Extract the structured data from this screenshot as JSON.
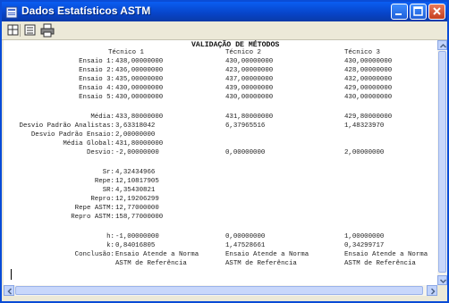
{
  "window": {
    "title": "Dados Estatísticos ASTM"
  },
  "report": {
    "heading": "VALIDAÇÃO DE MÉTODOS",
    "technicians": [
      "Técnico 1",
      "Técnico 2",
      "Técnico 3"
    ],
    "trials": [
      {
        "label": "Ensaio 1:",
        "values": [
          "438,00000000",
          "430,00000000",
          "430,00000000"
        ]
      },
      {
        "label": "Ensaio 2:",
        "values": [
          "436,00000000",
          "423,00000000",
          "428,00000000"
        ]
      },
      {
        "label": "Ensaio 3:",
        "values": [
          "435,00000000",
          "437,00000000",
          "432,00000000"
        ]
      },
      {
        "label": "Ensaio 4:",
        "values": [
          "430,00000000",
          "439,00000000",
          "429,00000000"
        ]
      },
      {
        "label": "Ensaio 5:",
        "values": [
          "430,00000000",
          "430,00000000",
          "430,00000000"
        ]
      }
    ],
    "media": {
      "label": "Média:",
      "values": [
        "433,80000000",
        "431,80000000",
        "429,80000000"
      ]
    },
    "desvio_analistas": {
      "label": "Desvio Padrão Analistas:",
      "values": [
        "3,63318042",
        "6,37965516",
        "1,48323970"
      ]
    },
    "desvio_ensaio": {
      "label": "Desvio Padrão Ensaio:",
      "value": "2,00000000"
    },
    "media_global": {
      "label": "Média Global:",
      "value": "431,80000000"
    },
    "desvio": {
      "label": "Desvio:",
      "values": [
        "-2,00000000",
        "0,00000000",
        "2,00000000"
      ]
    },
    "stats": [
      {
        "label": "Sr:",
        "value": "4,32434966"
      },
      {
        "label": "Repe:",
        "value": "12,10817905"
      },
      {
        "label": "SR:",
        "value": "4,35430821"
      },
      {
        "label": "Repro:",
        "value": "12,19206299"
      },
      {
        "label": "Repe ASTM:",
        "value": "12,77000000"
      },
      {
        "label": "Repro ASTM:",
        "value": "158,77000000"
      }
    ],
    "h": {
      "label": "h:",
      "values": [
        "-1,00000000",
        "0,00000000",
        "1,00000000"
      ]
    },
    "k": {
      "label": "k:",
      "values": [
        "0,84016805",
        "1,47528661",
        "0,34299717"
      ]
    },
    "conclusao": {
      "label": "Conclusão:",
      "line1": [
        "Ensaio Atende a Norma",
        "Ensaio Atende a Norma",
        "Ensaio Atende a Norma"
      ],
      "line2": [
        "ASTM de Referência",
        "ASTM de Referência",
        "ASTM de Referência"
      ]
    }
  }
}
